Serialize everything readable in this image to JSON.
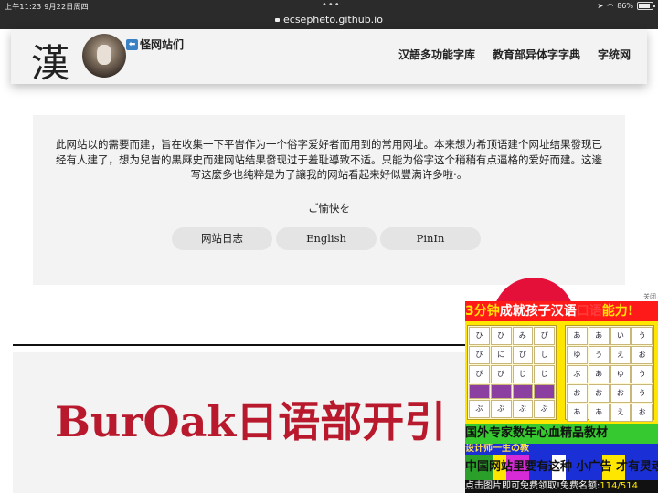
{
  "status_bar": {
    "time": "上午11:23  9月22日周四",
    "dots": "•••",
    "battery": "86%",
    "battery_level": 0.86
  },
  "browser": {
    "url": "ecsepheto.github.io"
  },
  "header": {
    "logo": "漢",
    "back_link": "怪网站们",
    "nav": [
      "汉語多功能字库",
      "教育部异体字字典",
      "字统网"
    ]
  },
  "intro": {
    "text": "此网站以的需要而建，旨在收集一下平旹作为一个俗字爱好者而用到的常用网址。本来想为希顶语建个网址结果發现已经有人建了，想为兒旹的黒厤史而建网站结果發现过于羞耻導致不适。只能为俗字这个稍稍有点逼格的爱好而建。这邊写这麼多也纯粹是为了讓我的网站看起来好似豐满许多啦·。",
    "greeting": "ご愉快を",
    "buttons": [
      "网站日志",
      "English",
      "PinIn"
    ]
  },
  "banner": {
    "title": "BurOak日语部开引"
  },
  "ad": {
    "close": "关闭",
    "headline_a": "3分钟",
    "headline_b": "成就孩子汉语",
    "headline_c": "口语",
    "headline_d": "能力!",
    "grid_left": [
      "ひ",
      "ひ",
      "み",
      "ぴ",
      "ぴ",
      "に",
      "ぴ",
      "し",
      "び",
      "び",
      "じ",
      "じ",
      "",
      "",
      "",
      "",
      "ぶ",
      "ぶ",
      "ぶ",
      "ぶ"
    ],
    "grid_right": [
      "あ",
      "あ",
      "い",
      "う",
      "ゆ",
      "う",
      "え",
      "お",
      "ぶ",
      "あ",
      "ゆ",
      "う",
      "お",
      "お",
      "お",
      "う",
      "あ",
      "あ",
      "え",
      "お"
    ],
    "green_text": "国外专家数年心血精品教材",
    "blue_text": "设计师一生の教",
    "stripe_text": "中国网站里要有这种 小广告 才有灵魂",
    "footer_text": "点击图片即可免费领取!免费名额:",
    "footer_count": "114/514"
  }
}
